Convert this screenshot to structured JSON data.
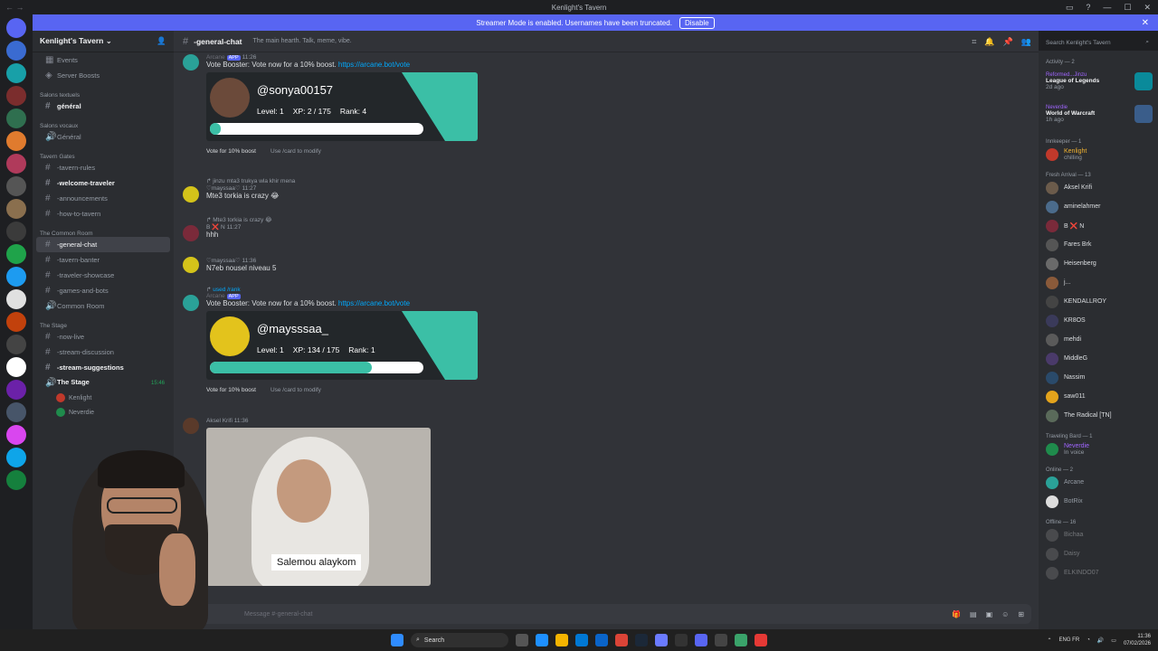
{
  "window": {
    "title": "Kenlight's Tavern"
  },
  "banner": {
    "text": "Streamer Mode is enabled. Usernames have been truncated.",
    "button": "Disable"
  },
  "server": {
    "name": "Kenlight's Tavern"
  },
  "sidebar": {
    "top": [
      "Events",
      "Server Boosts"
    ],
    "cat_text": "Salons textuels",
    "general_text": "général",
    "cat_voice": "Salons vocaux",
    "general_voice": "Général",
    "cat_gates": "Tavern Gates",
    "gates": [
      "-tavern-rules",
      "-welcome-traveler",
      "-announcements",
      "-how-to-tavern"
    ],
    "cat_common": "The Common Room",
    "common": [
      "-general-chat",
      "-tavern-banter",
      "-traveler-showcase",
      "-games-and-bots",
      "Common Room"
    ],
    "cat_stage": "The Stage",
    "stage": [
      "-now-live",
      "-stream-discussion",
      "-stream-suggestions"
    ],
    "stage_voice": "The Stage",
    "stage_time": "15:46",
    "stage_users": [
      "Kenlight",
      "Neverdie"
    ]
  },
  "channel": {
    "name": "-general-chat",
    "topic": "The main hearth. Talk, meme, vibe."
  },
  "search": {
    "placeholder": "Search Kenlight's Tavern"
  },
  "messages": {
    "m1": {
      "user": "Arcane",
      "badge": "APP",
      "time": "11:26",
      "text": "Vote Booster: Vote now for a 10% boost.",
      "link": "https://arcane.bot/vote",
      "card": {
        "handle": "@sonya00157",
        "level": "Level: 1",
        "xp": "XP: 2 / 175",
        "rank": "Rank: 4",
        "progress": 0.01
      },
      "btn1": "Vote for 10% boost",
      "btn2": "Use /card to modify"
    },
    "m2": {
      "reply": "jinzu mta3 trukya wla khir mena",
      "user": "♡mayssaa♡",
      "time": "11:27",
      "text": "Mte3 torkia is crazy 😂"
    },
    "m3": {
      "reply": "Mte3 torkia is crazy 😂",
      "user": "B ❌ N",
      "time": "11:27",
      "text": "hhh"
    },
    "m4": {
      "user": "♡mayssaa♡",
      "time": "11:36",
      "text": "N7eb nousel niveau 5"
    },
    "m5": {
      "reply": "used /rank",
      "user": "Arcane",
      "badge": "APP",
      "time": "11:36",
      "text": "Vote Booster: Vote now for a 10% boost.",
      "link": "https://arcane.bot/vote",
      "card": {
        "handle": "@maysssaa_",
        "level": "Level: 1",
        "xp": "XP: 134 / 175",
        "rank": "Rank: 1",
        "progress": 0.76
      },
      "btn1": "Vote for 10% boost",
      "btn2": "Use /card to modify"
    },
    "m6": {
      "user": "Aksel Krifi",
      "time": "11:36",
      "caption": "Salemou alaykom"
    }
  },
  "composer": {
    "placeholder": "Message #-general-chat"
  },
  "members": {
    "activity_hdr": "Activity — 2",
    "activities": [
      {
        "name": "Reformed...Jinzu",
        "game": "League of Legends",
        "time": "2d ago"
      },
      {
        "name": "Neverdie",
        "game": "World of Warcraft",
        "time": "1h ago"
      }
    ],
    "innkeeper_hdr": "Innkeeper — 1",
    "innkeeper": [
      {
        "name": "Kenlight",
        "sub": "chilling"
      }
    ],
    "fresh_hdr": "Fresh Arrival — 13",
    "fresh": [
      "Aksel Krifi",
      "aminelahmer",
      "B ❌ N",
      "Fares Brk",
      "Heisenberg",
      "j...",
      "KENDALLROY",
      "KR8OS",
      "mehdi",
      "MiddleG",
      "Nassim",
      "saw011",
      "The Radical [TN]"
    ],
    "bard_hdr": "Traveling Bard — 1",
    "bard": [
      {
        "name": "Neverdie",
        "sub": "In voice"
      }
    ],
    "online_hdr": "Online — 2",
    "online": [
      "Arcane",
      "BotRix"
    ],
    "offline_hdr": "Offline — 16",
    "offline": [
      "Bichaa",
      "Daisy",
      "ELKINDO07"
    ]
  },
  "taskbar": {
    "search": "Search",
    "lang": "ENG FR",
    "time": "11:36",
    "date": "07/02/2026"
  }
}
